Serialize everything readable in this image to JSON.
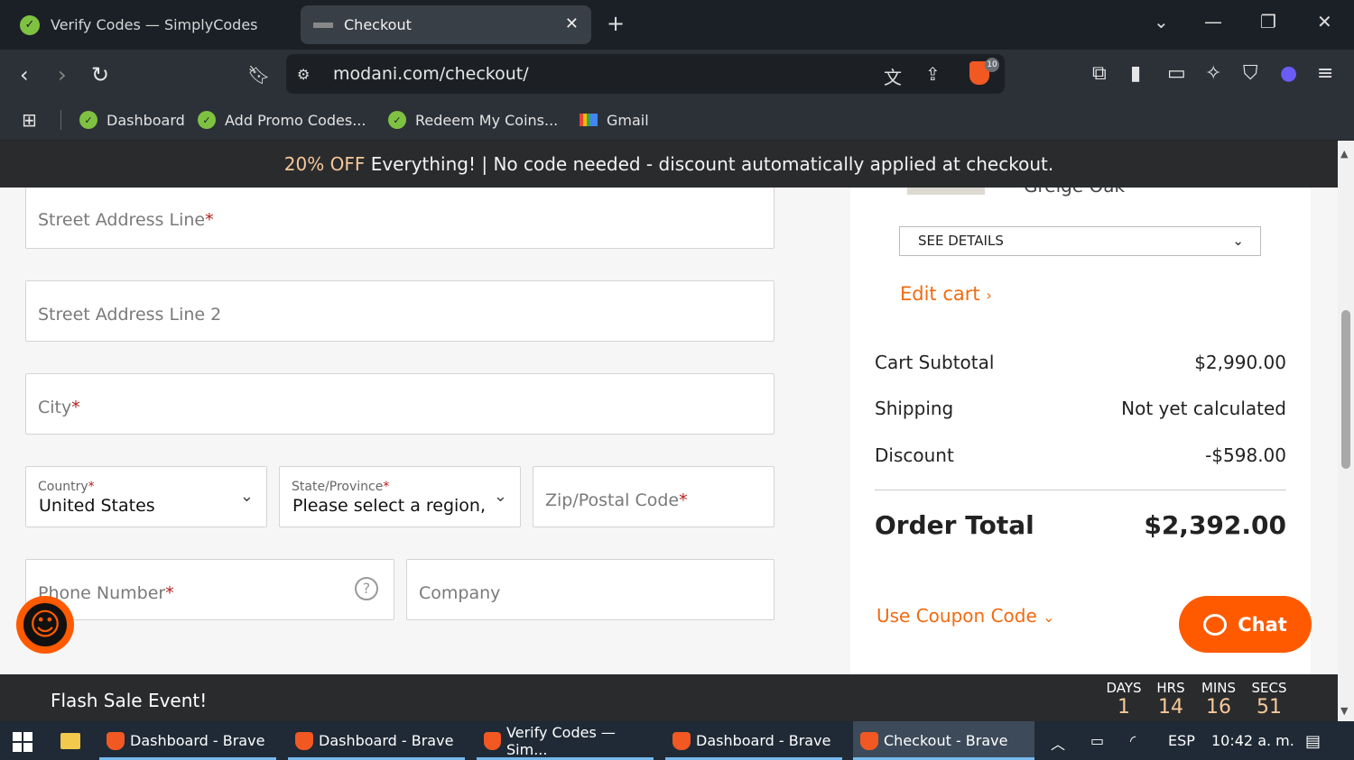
{
  "browser": {
    "tabs": [
      {
        "title": "Verify Codes — SimplyCodes",
        "active": false
      },
      {
        "title": "Checkout",
        "active": true
      }
    ],
    "url": "modani.com/checkout/",
    "shield_count": "10",
    "bookmarks": [
      "Dashboard",
      "Add Promo Codes...",
      "Redeem My Coins...",
      "Gmail"
    ]
  },
  "promo_banner": {
    "highlight": "20% OFF",
    "text": " Everything! | No code needed - discount automatically applied at checkout."
  },
  "form": {
    "street1_placeholder": "Street Address Line",
    "street2_placeholder": "Street Address Line 2",
    "city_placeholder": "City",
    "country_label": "Country",
    "country_value": "United States",
    "state_label": "State/Province",
    "state_value": "Please select a region,",
    "zip_placeholder": "Zip/Postal Code",
    "phone_placeholder": "Phone Number",
    "company_placeholder": "Company",
    "required_mark": "*"
  },
  "summary": {
    "product_name_partial": "Greige Oak",
    "see_details": "SEE DETAILS",
    "edit_cart": "Edit cart",
    "subtotal_label": "Cart Subtotal",
    "subtotal_value": "$2,990.00",
    "shipping_label": "Shipping",
    "shipping_value": "Not yet calculated",
    "discount_label": "Discount",
    "discount_value": "-$598.00",
    "total_label": "Order Total",
    "total_value": "$2,392.00",
    "coupon_label": "Use Coupon Code"
  },
  "chat": {
    "label": "Chat"
  },
  "flash_sale": {
    "title": "Flash Sale Event!",
    "countdown": [
      {
        "label": "DAYS",
        "value": "1"
      },
      {
        "label": "HRS",
        "value": "14"
      },
      {
        "label": "MINS",
        "value": "16"
      },
      {
        "label": "SECS",
        "value": "51"
      }
    ]
  },
  "taskbar": {
    "items": [
      {
        "title": "Dashboard - Brave"
      },
      {
        "title": "Dashboard - Brave"
      },
      {
        "title": "Verify Codes — Sim..."
      },
      {
        "title": "Dashboard - Brave"
      },
      {
        "title": "Checkout - Brave"
      }
    ],
    "language": "ESP",
    "time": "10:42 a. m."
  },
  "colors": {
    "accent": "#f26a10",
    "chat": "#ff5a00",
    "promo_highlight": "#f6c89a"
  }
}
